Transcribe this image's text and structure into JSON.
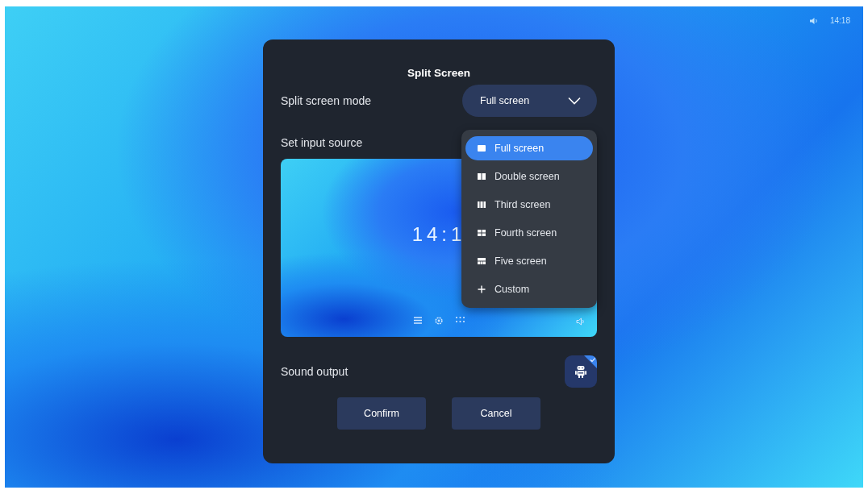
{
  "status_bar": {
    "time": "14:18"
  },
  "dialog": {
    "title": "Split Screen",
    "mode": {
      "label": "Split screen mode",
      "value": "Full screen",
      "expanded": true
    },
    "menu": [
      {
        "label": "Full screen",
        "kind": "full",
        "selected": true
      },
      {
        "label": "Double screen",
        "kind": "double",
        "selected": false
      },
      {
        "label": "Third screen",
        "kind": "third",
        "selected": false
      },
      {
        "label": "Fourth screen",
        "kind": "fourth",
        "selected": false
      },
      {
        "label": "Five screen",
        "kind": "five",
        "selected": false
      },
      {
        "label": "Custom",
        "kind": "custom",
        "selected": false
      }
    ],
    "input_source": {
      "label": "Set input source",
      "preview": {
        "time": "14:1"
      }
    },
    "sound_output": {
      "label": "Sound output",
      "checked": true
    },
    "buttons": [
      {
        "label": "Confirm"
      },
      {
        "label": "Cancel"
      }
    ]
  }
}
